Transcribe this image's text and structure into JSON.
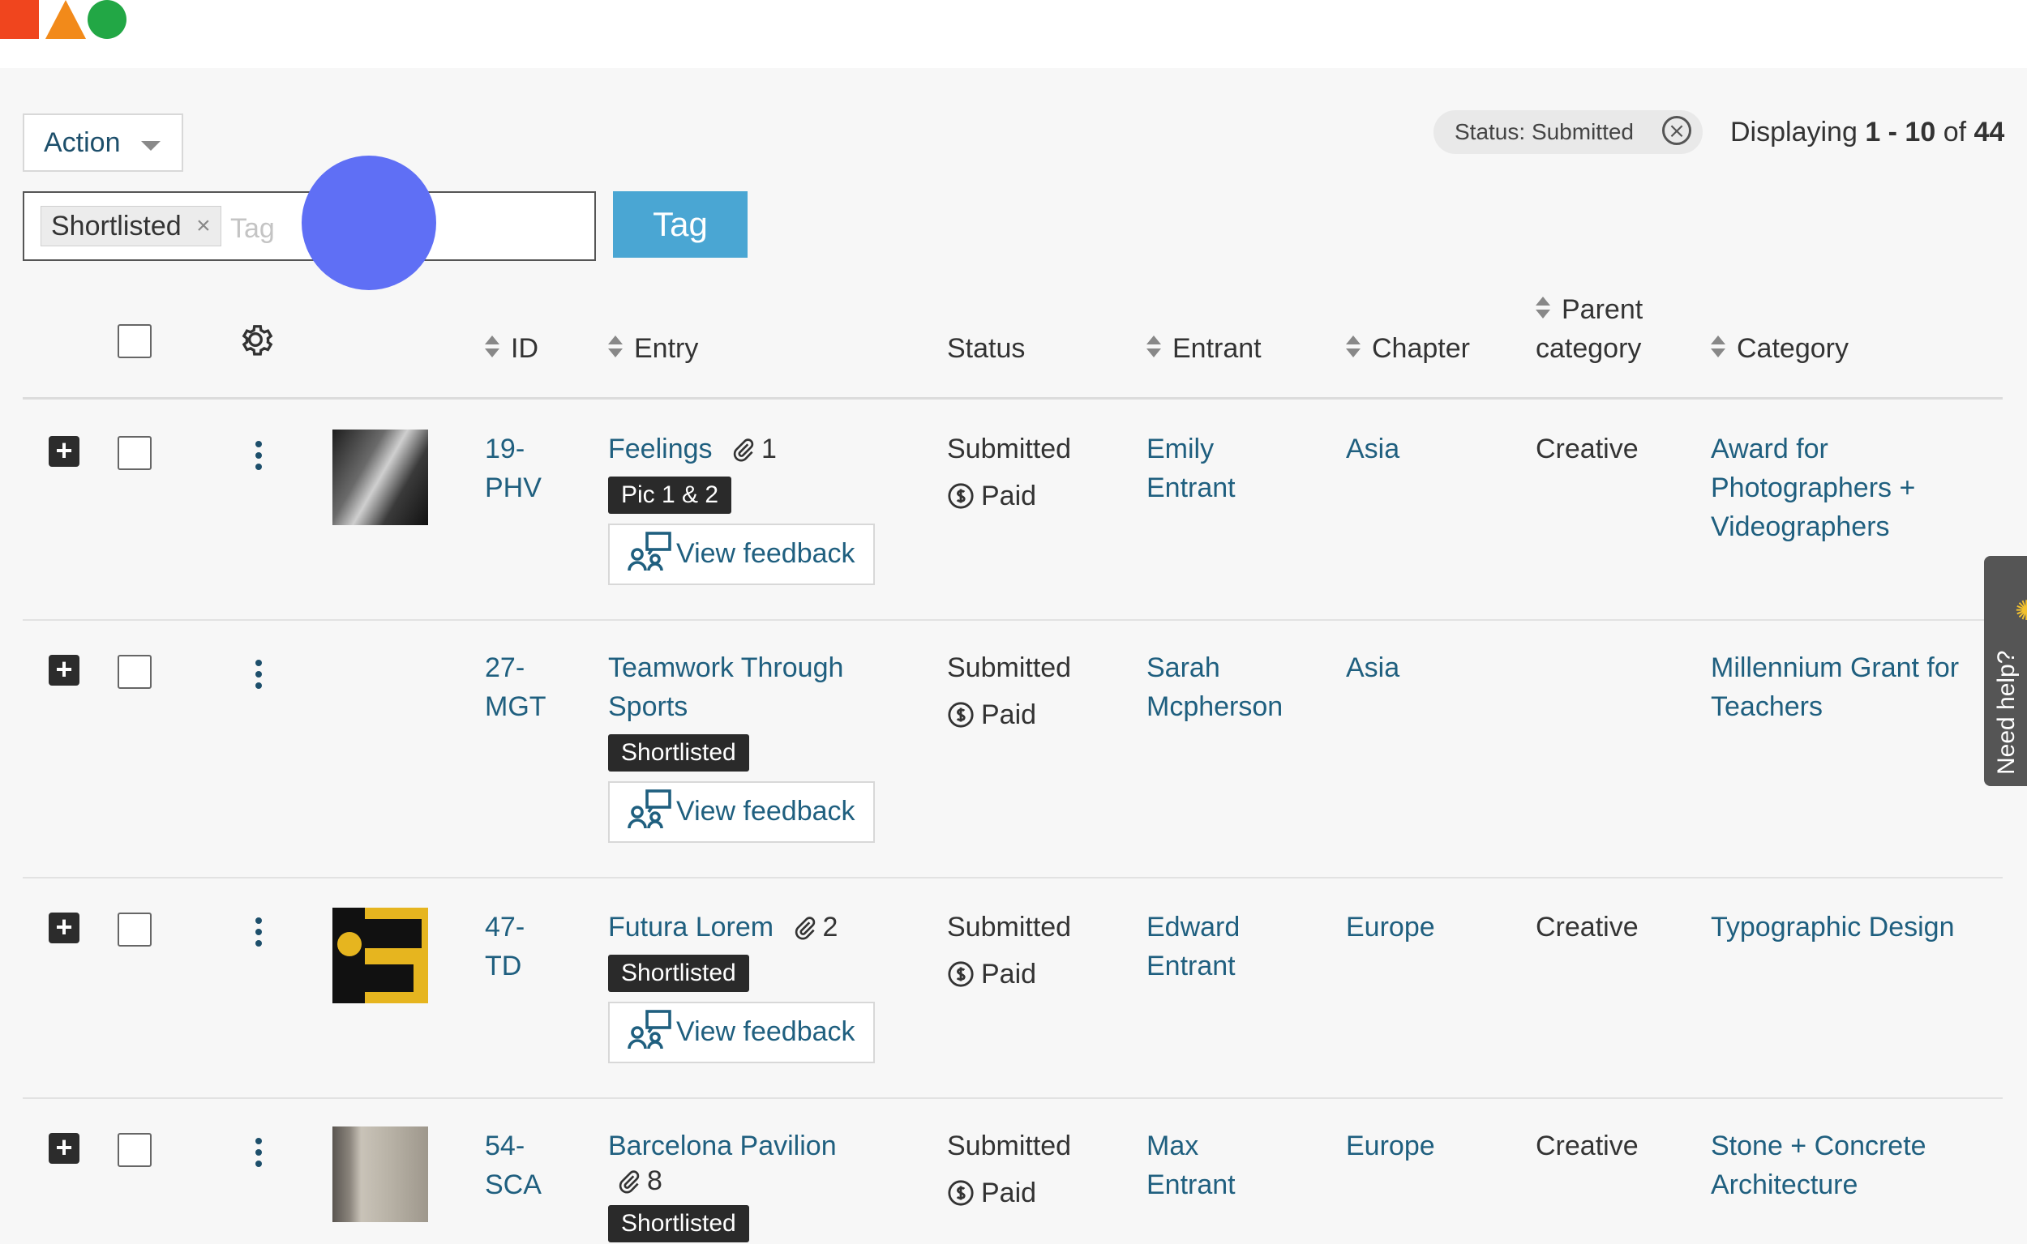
{
  "toolbar": {
    "action_label": "Action",
    "status_filter_label": "Status: Submitted",
    "status_filter_clear": "⨯",
    "displaying_prefix": "Displaying ",
    "displaying_range": "1 - 10",
    "displaying_of": " of ",
    "displaying_total": "44"
  },
  "tagger": {
    "chip_label": "Shortlisted",
    "chip_remove": "×",
    "placeholder": "Tag",
    "button_label": "Tag"
  },
  "table": {
    "headers": {
      "id": "ID",
      "entry": "Entry",
      "status": "Status",
      "entrant": "Entrant",
      "chapter": "Chapter",
      "parent_category_1": "Parent",
      "parent_category_2": "category",
      "category": "Category"
    },
    "rows": [
      {
        "id_1": "19-",
        "id_2": "PHV",
        "entry": "Feelings",
        "attachments": "1",
        "tag": "Pic 1 & 2",
        "feedback": "View feedback",
        "status": "Submitted",
        "payment": "Paid",
        "entrant_1": "Emily",
        "entrant_2": "Entrant",
        "chapter": "Asia",
        "parent_category": "Creative",
        "category_1": "Award for",
        "category_2": "Photographers +",
        "category_3": "Videographers"
      },
      {
        "id_1": "27-",
        "id_2": "MGT",
        "entry_1": "Teamwork Through",
        "entry_2": "Sports",
        "tag": "Shortlisted",
        "feedback": "View feedback",
        "status": "Submitted",
        "payment": "Paid",
        "entrant_1": "Sarah",
        "entrant_2": "Mcpherson",
        "chapter": "Asia",
        "parent_category": "",
        "category_1": "Millennium Grant for",
        "category_2": "Teachers"
      },
      {
        "id_1": "47-",
        "id_2": "TD",
        "entry": "Futura Lorem",
        "attachments": "2",
        "tag": "Shortlisted",
        "feedback": "View feedback",
        "status": "Submitted",
        "payment": "Paid",
        "entrant_1": "Edward",
        "entrant_2": "Entrant",
        "chapter": "Europe",
        "parent_category": "Creative",
        "category_1": "Typographic Design"
      },
      {
        "id_1": "54-",
        "id_2": "SCA",
        "entry": "Barcelona Pavilion",
        "attachments": "8",
        "tag": "Shortlisted",
        "status": "Submitted",
        "payment": "Paid",
        "entrant_1": "Max",
        "entrant_2": "Entrant",
        "chapter": "Europe",
        "parent_category": "Creative",
        "category_1": "Stone + Concrete",
        "category_2": "Architecture"
      }
    ]
  },
  "help": {
    "label": "Need help?"
  },
  "colors": {
    "link": "#1f5f7f",
    "tag_button": "#4aa6d3",
    "badge": "#2a2a2a",
    "cursor": "#5f6ff5"
  }
}
